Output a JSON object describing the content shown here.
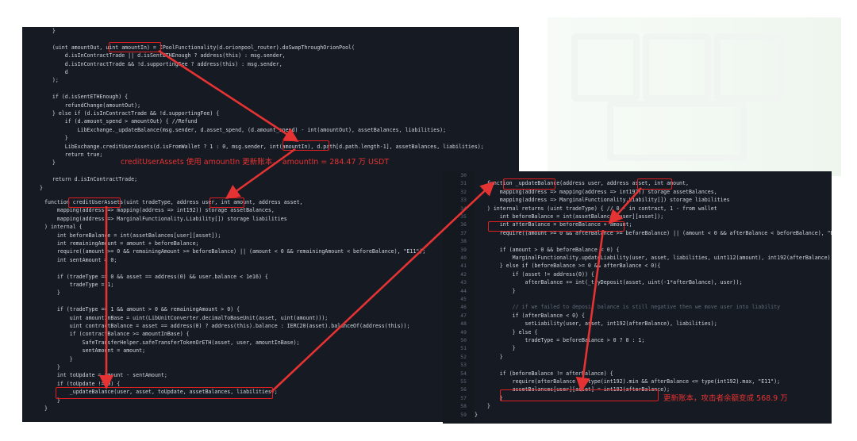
{
  "panel1": {
    "lines": [
      "    }",
      "",
      "    (uint amountOut, uint amountIn) = IPoolFunctionality(d.orionpool_router).doSwapThroughOrionPool(",
      "        d.isInContractTrade || d.isSentETHEnough ? address(this) : msg.sender,",
      "        d.isInContractTrade && !d.supportingFee ? address(this) : msg.sender,",
      "        d",
      "    );",
      "",
      "    if (d.isSentETHEnough) {",
      "        refundChange(amountOut);",
      "    } else if (d.isInContractTrade && !d.supportingFee) {",
      "        if (d.amount_spend > amountOut) { //Refund",
      "            LibExchange._updateBalance(msg.sender, d.asset_spend, (d.amount_spend) - int(amountOut), assetBalances, liabilities);",
      "        }",
      "        LibExchange.creditUserAssets(d.isFromWallet ? 1 : 0, msg.sender, int(amountIn), d.path[d.path.length-1], assetBalances, liabilities);",
      "        return true;",
      "    }",
      "",
      "    return d.isInContractTrade;",
      "}"
    ]
  },
  "panel2": {
    "lines": [
      "function creditUserAssets(uint tradeType, address user, int amount, address asset,",
      "    mapping(address => mapping(address => int192)) storage assetBalances,",
      "    mapping(address => MarginalFunctionality.Liability[]) storage liabilities",
      ") internal {",
      "    int beforeBalance = int(assetBalances[user][asset]);",
      "    int remainingAmount = amount + beforeBalance;",
      "    require((amount >= 0 && remainingAmount >= beforeBalance) || (amount < 0 && remainingAmount < beforeBalance), \"E11\");",
      "    int sentAmount = 0;",
      "",
      "    if (tradeType == 0 && asset == address(0) && user.balance < 1e16) {",
      "        tradeType = 1;",
      "    }",
      "",
      "    if (tradeType == 1 && amount > 0 && remainingAmount > 0) {",
      "        uint amountInBase = uint(LibUnitConverter.decimalToBaseUnit(asset, uint(amount)));",
      "        uint contractBalance = asset == address(0) ? address(this).balance : IERC20(asset).balanceOf(address(this));",
      "        if (contractBalance >= amountInBase) {",
      "            SafeTransferHelper.safeTransferTokenOrETH(asset, user, amountInBase);",
      "            sentAmount = amount;",
      "        }",
      "    }",
      "    int toUpdate = amount - sentAmount;",
      "    if (toUpdate != 0) {",
      "        _updateBalance(user, asset, toUpdate, assetBalances, liabilities);",
      "    }",
      "}"
    ]
  },
  "panel3": {
    "line_numbers": [
      "30",
      "31",
      "32",
      "33",
      "34",
      "35",
      "36",
      "37",
      "38",
      "39",
      "40",
      "41",
      "42",
      "43",
      "44",
      "45",
      "46",
      "47",
      "48",
      "49",
      "50",
      "51",
      "52",
      "53",
      "54",
      "55",
      "56",
      "57",
      "58",
      "59"
    ],
    "lines": [
      "",
      "    function _updateBalance(address user, address asset, int amount,",
      "        mapping(address => mapping(address => int192)) storage assetBalances,",
      "        mapping(address => MarginalFunctionality.Liability[]) storage liabilities",
      "    ) internal returns (uint tradeType) { // 0 - in contract, 1 - from wallet",
      "        int beforeBalance = int(assetBalances[user][asset]);",
      "        int afterBalance = beforeBalance + amount;",
      "        require((amount >= 0 && afterBalance >= beforeBalance) || (amount < 0 && afterBalance < beforeBalance), \"E11\");",
      "",
      "        if (amount > 0 && beforeBalance < 0) {",
      "            MarginalFunctionality.updateLiability(user, asset, liabilities, uint112(amount), int192(afterBalance));",
      "        } else if (beforeBalance >= 0 && afterBalance < 0){",
      "            if (asset != address(0)) {",
      "                afterBalance += int(_tryDeposit(asset, uint(-1*afterBalance), user));",
      "            }",
      "",
      "            // if we failed to deposit balance is still negative then we move user into liability",
      "            if (afterBalance < 0) {",
      "                setLiability(user, asset, int192(afterBalance), liabilities);",
      "            } else {",
      "                tradeType = beforeBalance > 0 ? 0 : 1;",
      "            }",
      "        }",
      "",
      "        if (beforeBalance != afterBalance) {",
      "            require(afterBalance >= type(int192).min && afterBalance <= type(int192).max, \"E11\");",
      "            assetBalances[user][asset] = int192(afterBalance);",
      "        }",
      "    }",
      "}"
    ]
  },
  "annotations": {
    "note1": "creditUserAssets 使用 amountIn 更新账本，  amountIn = 284.47 万 USDT",
    "note2": "更新账本，攻击者余额变成 568.9 万"
  },
  "colors": {
    "editor_bg": "#161a22",
    "code_text": "#cfd6e0",
    "keyword": "#5a8fd6",
    "comment": "#5f6b7a",
    "highlight": "#e02020",
    "annotation": "#e53333"
  }
}
